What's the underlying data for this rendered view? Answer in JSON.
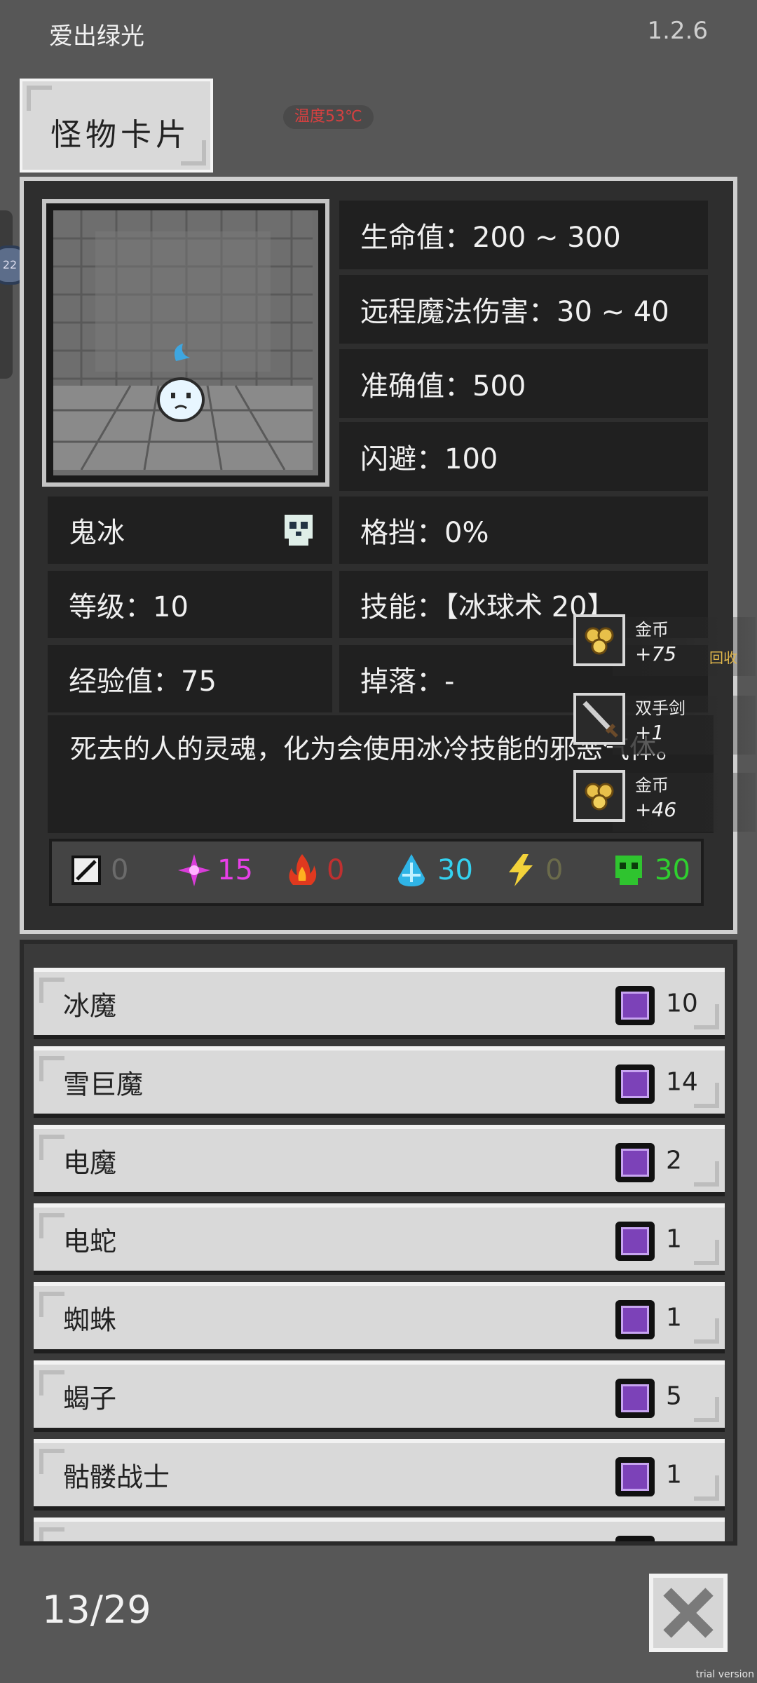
{
  "header": {
    "app_title": "爱出绿光",
    "version": "1.2.6"
  },
  "tab": {
    "label": "怪物卡片"
  },
  "temperature": "温度53℃",
  "side": {
    "ring_text": "22"
  },
  "monster": {
    "name": "鬼冰",
    "level": "等级：10",
    "exp": "经验值：75",
    "hp": "生命值：200 ~ 300",
    "ranged_magic_damage": "远程魔法伤害：30 ~ 40",
    "accuracy": "准确值：500",
    "dodge": "闪避：100",
    "block": "格挡：0%",
    "skills": "技能：【冰球术 20】",
    "drops": "掉落：-",
    "description": "死去的人的灵魂，化为会使用冰冷技能的邪恶气体。"
  },
  "resistances": [
    {
      "icon": "physical-shield-icon",
      "value": "0",
      "color": "#6b6b6b"
    },
    {
      "icon": "arcane-star-icon",
      "value": "15",
      "color": "#e83fe8"
    },
    {
      "icon": "fire-icon",
      "value": "0",
      "color": "#c03030"
    },
    {
      "icon": "ice-drop-icon",
      "value": "30",
      "color": "#34d2f0"
    },
    {
      "icon": "lightning-icon",
      "value": "0",
      "color": "#6b6b4b"
    },
    {
      "icon": "poison-skull-icon",
      "value": "30",
      "color": "#2fd02f"
    }
  ],
  "drop_popup": {
    "items": [
      {
        "name": "金币",
        "qty": "+75",
        "icon": "gold-coins-icon"
      },
      {
        "name": "双手剑",
        "qty": "+1",
        "icon": "two-handed-sword-icon"
      },
      {
        "name": "金币",
        "qty": "+46",
        "icon": "gold-coins-icon"
      }
    ],
    "recycle_label": "回收"
  },
  "list": [
    {
      "name": "冰魔",
      "count": "10"
    },
    {
      "name": "雪巨魔",
      "count": "14"
    },
    {
      "name": "电魔",
      "count": "2"
    },
    {
      "name": "电蛇",
      "count": "1"
    },
    {
      "name": "蜘蛛",
      "count": "1"
    },
    {
      "name": "蝎子",
      "count": "5"
    },
    {
      "name": "骷髅战士",
      "count": "1"
    }
  ],
  "footer": {
    "page": "13/29",
    "trial": "trial version"
  }
}
